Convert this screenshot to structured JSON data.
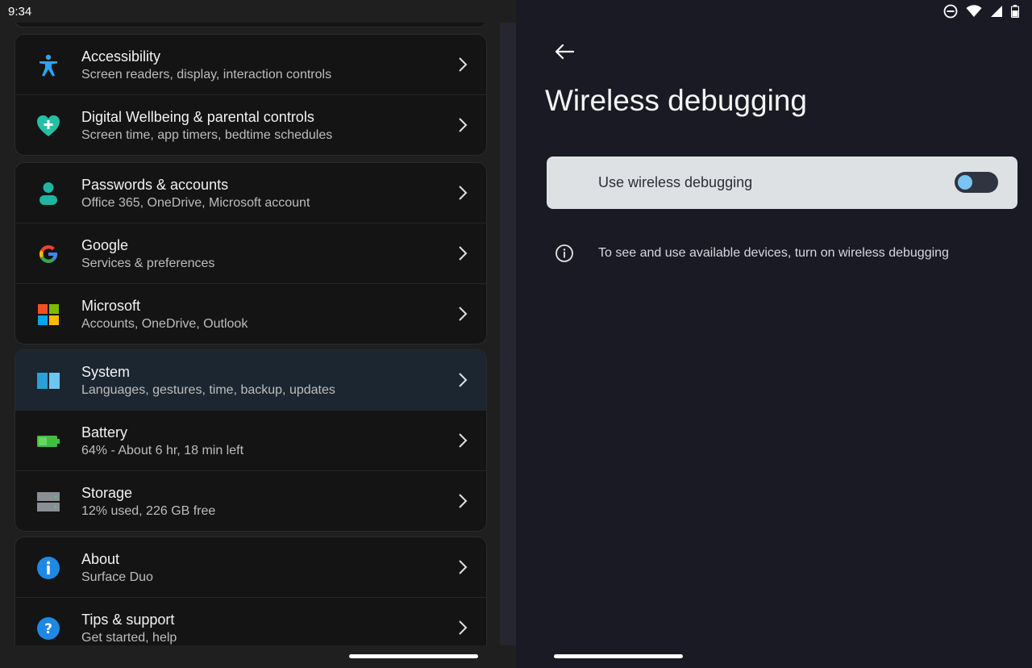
{
  "status_bar": {
    "time": "9:34"
  },
  "settings": {
    "groups": [
      {
        "items": [
          {
            "title": "Accessibility",
            "subtitle": "Screen readers, display, interaction controls",
            "icon": "accessibility-icon"
          },
          {
            "title": "Digital Wellbeing & parental controls",
            "subtitle": "Screen time, app timers, bedtime schedules",
            "icon": "wellbeing-heart-icon"
          }
        ]
      },
      {
        "items": [
          {
            "title": "Passwords & accounts",
            "subtitle": "Office 365, OneDrive, Microsoft account",
            "icon": "account-person-icon"
          },
          {
            "title": "Google",
            "subtitle": "Services & preferences",
            "icon": "google-icon"
          },
          {
            "title": "Microsoft",
            "subtitle": "Accounts, OneDrive, Outlook",
            "icon": "microsoft-logo-icon"
          }
        ]
      },
      {
        "items": [
          {
            "title": "System",
            "subtitle": "Languages, gestures, time, backup, updates",
            "icon": "system-dual-screen-icon",
            "selected": true
          },
          {
            "title": "Battery",
            "subtitle": "64% - About 6 hr, 18 min left",
            "icon": "battery-icon"
          },
          {
            "title": "Storage",
            "subtitle": "12% used, 226 GB free",
            "icon": "storage-icon"
          }
        ]
      },
      {
        "items": [
          {
            "title": "About",
            "subtitle": "Surface Duo",
            "icon": "info-circle-icon"
          },
          {
            "title": "Tips & support",
            "subtitle": "Get started, help",
            "icon": "help-circle-icon"
          }
        ]
      }
    ]
  },
  "detail": {
    "title": "Wireless debugging",
    "toggle": {
      "label": "Use wireless debugging",
      "on": false
    },
    "info": "To see and use available devices, turn on wireless debugging"
  },
  "colors": {
    "accent": "#79c4f2",
    "card": "#dde1e4",
    "background": "#1a1a24"
  }
}
